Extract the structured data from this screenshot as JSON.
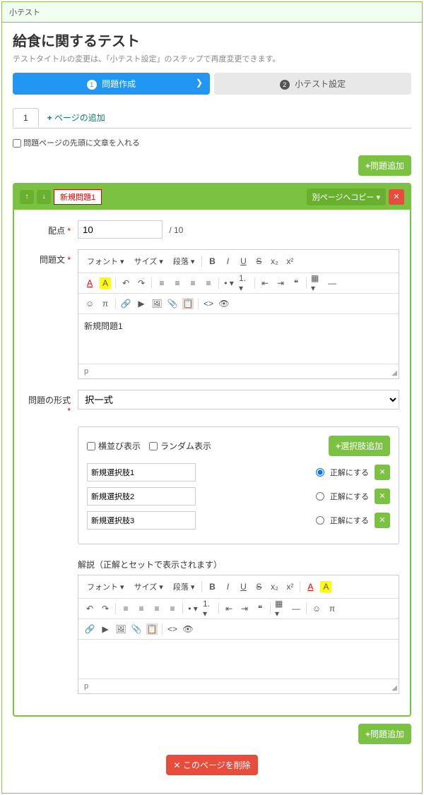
{
  "header": {
    "label": "小テスト"
  },
  "page": {
    "title": "給食に関するテスト",
    "subtitle": "テストタイトルの変更は、「小テスト設定」のステップで再度変更できます。"
  },
  "steps": {
    "s1": "問題作成",
    "s2": "小テスト設定"
  },
  "tabs": {
    "t1": "1",
    "addPage": "ページの追加"
  },
  "checkbox1": "問題ページの先頭に文章を入れる",
  "buttons": {
    "addQuestion": "問題追加",
    "copyPage": "別ページへコピー",
    "addChoice": "選択肢追加",
    "deletePage": "このページを削除"
  },
  "question": {
    "name": "新規問題1",
    "scoreLabel": "配点",
    "scoreValue": "10",
    "scoreMax": "/ 10",
    "textLabel": "問題文",
    "formatLabel": "問題の形式",
    "formatValue": "択一式",
    "bodyText": "新規問題1"
  },
  "editor": {
    "font": "フォント",
    "size": "サイズ",
    "para": "段落",
    "status": "p"
  },
  "options": {
    "horizontal": "横並び表示",
    "random": "ランダム表示",
    "correctLabel": "正解にする",
    "opt1": "新規選択肢1",
    "opt2": "新規選択肢2",
    "opt3": "新規選択肢3"
  },
  "explain": {
    "label": "解説（正解とセットで表示されます）"
  }
}
